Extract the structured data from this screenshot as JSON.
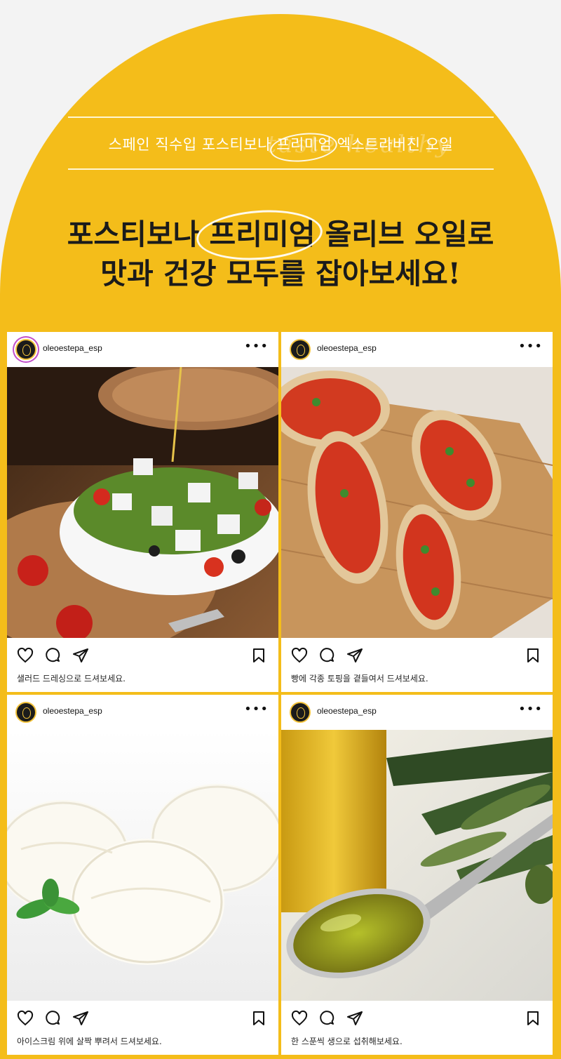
{
  "banner": {
    "subtitle": "스페인 직수입 포스티보나 프리미엄 엑스트라버진 오일",
    "script_decoration": "taste healthy",
    "headline_line1": "포스티보나 프리미엄 올리브 오일로",
    "headline_line2": "맛과 건강 모두를 잡아보세요!"
  },
  "colors": {
    "brand_yellow": "#f4bd1a",
    "background": "#f3f3f3"
  },
  "posts": [
    {
      "username": "oleoestepa_esp",
      "more": "•••",
      "image": "greek-salad-with-olive-oil",
      "caption": "샐러드 드레싱으로 드셔보세요."
    },
    {
      "username": "oleoestepa_esp",
      "more": "•••",
      "image": "tomato-bruschetta",
      "caption": "빵에 각종 토핑을 곁들여서 드셔보세요."
    },
    {
      "username": "oleoestepa_esp",
      "more": "•••",
      "image": "vanilla-ice-cream-scoops",
      "caption": "아이스크림 위에 살짝 뿌려서 드셔보세요."
    },
    {
      "username": "oleoestepa_esp",
      "more": "•••",
      "image": "olive-oil-spoon",
      "caption": "한 스푼씩 생으로 섭취해보세요."
    }
  ],
  "icons": [
    "heart-icon",
    "comment-icon",
    "share-icon",
    "bookmark-icon",
    "more-icon"
  ]
}
